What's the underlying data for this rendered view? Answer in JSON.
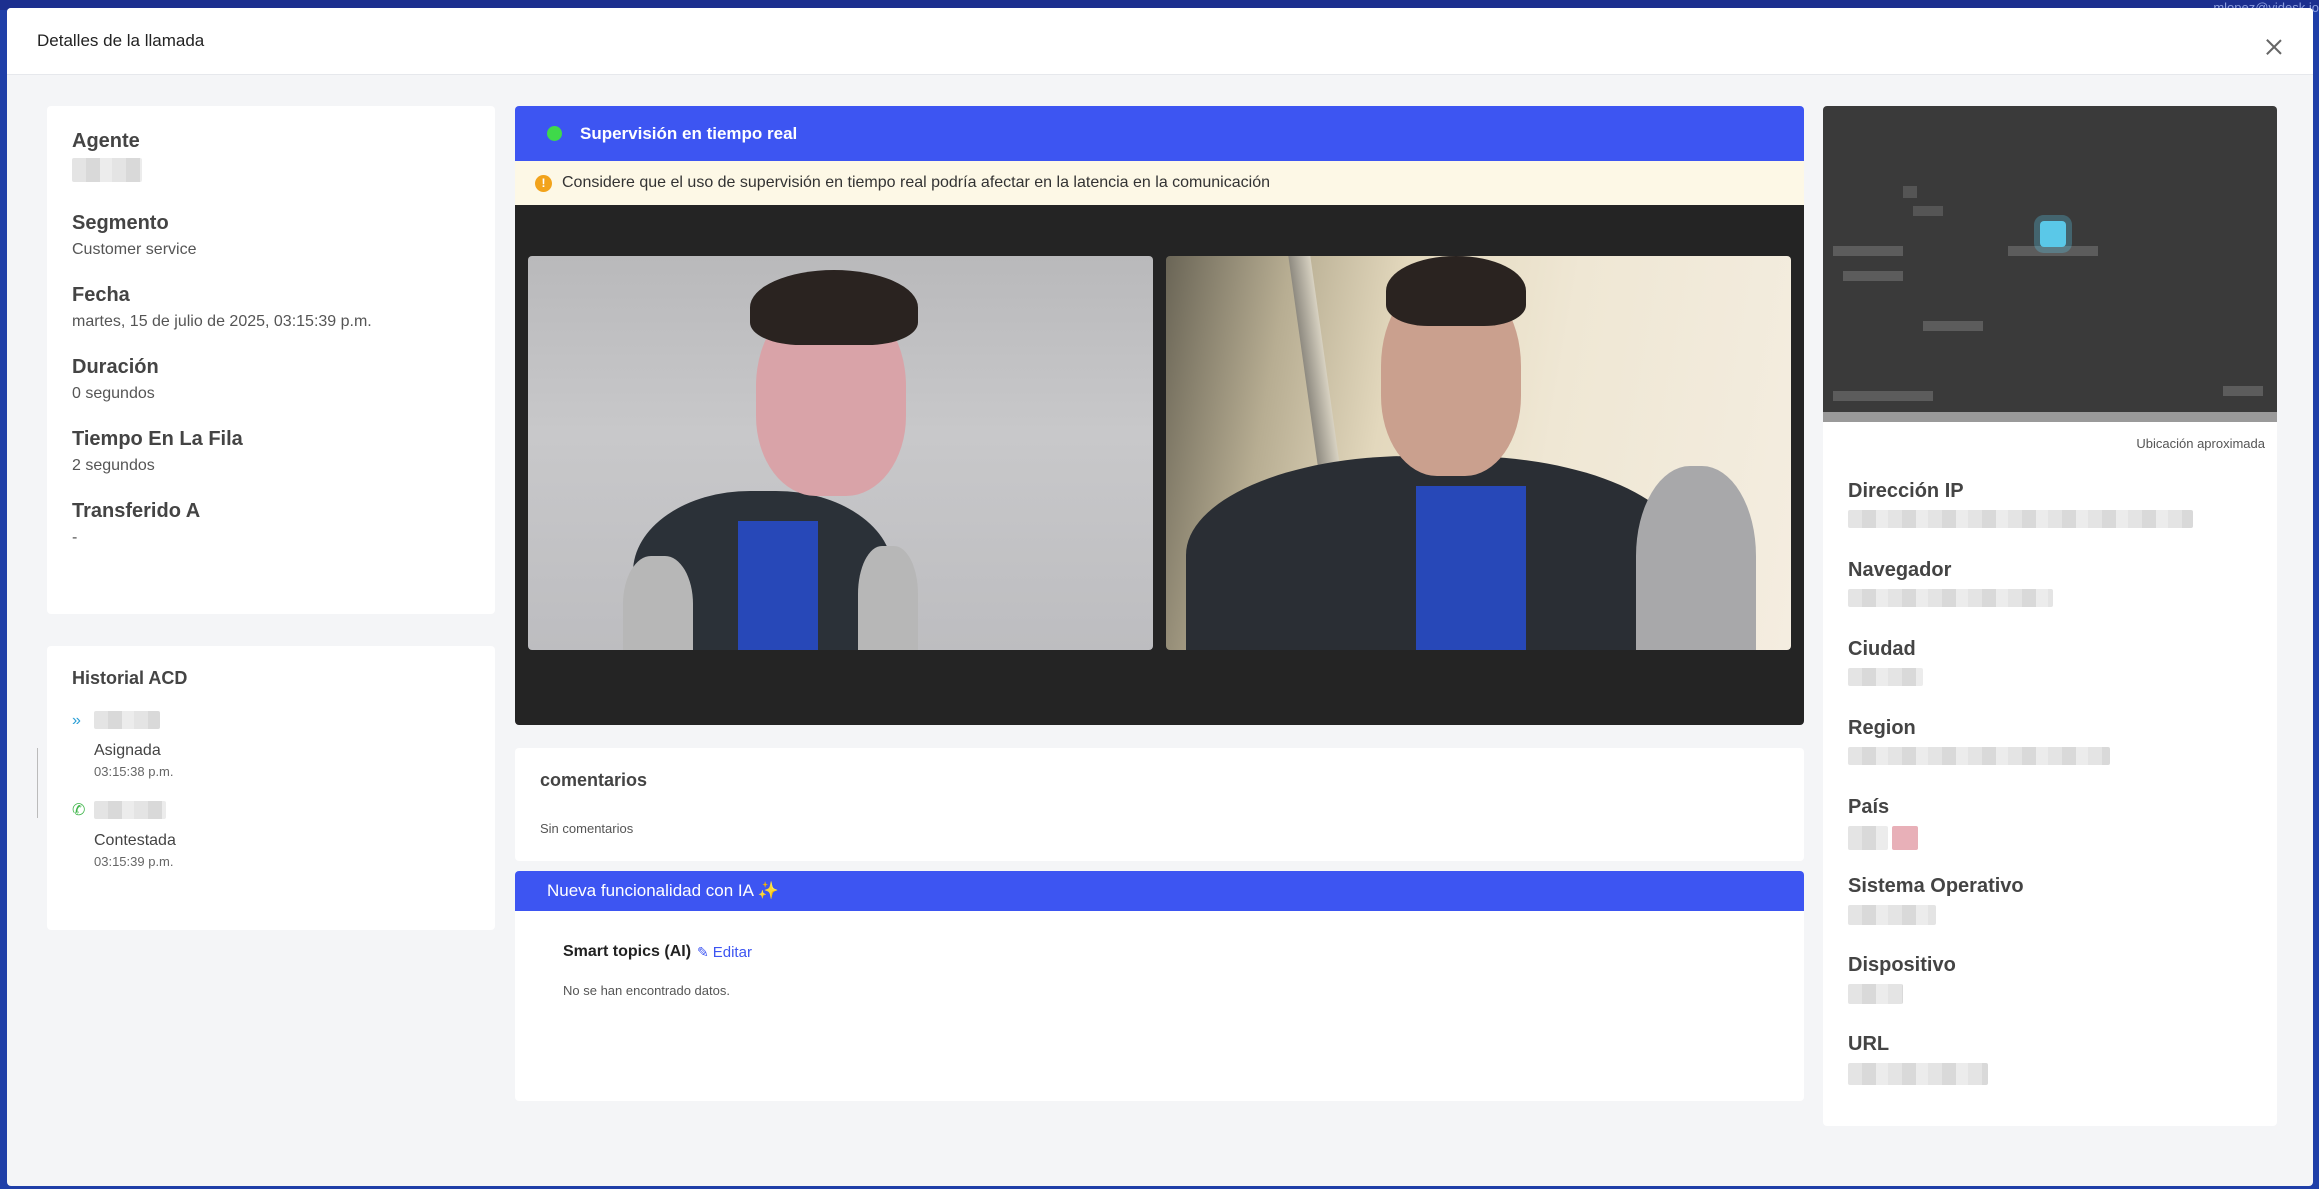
{
  "backdrop": {
    "user_text": "mlopez@videsk.io"
  },
  "modal": {
    "title": "Detalles de la llamada"
  },
  "info": [
    {
      "label": "Agente",
      "value": ""
    },
    {
      "label": "Segmento",
      "value": "Customer service"
    },
    {
      "label": "Fecha",
      "value": "martes, 15 de julio de 2025, 03:15:39 p.m."
    },
    {
      "label": "Duración",
      "value": "0 segundos"
    },
    {
      "label": "Tiempo En La Fila",
      "value": "2 segundos"
    },
    {
      "label": "Transferido A",
      "value": "-"
    }
  ],
  "acd": {
    "title": "Historial ACD",
    "items": [
      {
        "icon": "double-chevron-right-icon",
        "status": "Asignada",
        "time": "03:15:38 p.m."
      },
      {
        "icon": "phone-icon",
        "status": "Contestada",
        "time": "03:15:39 p.m."
      }
    ]
  },
  "supervision": {
    "title": "Supervisión en tiempo real",
    "status_color": "#3fd94a",
    "warning": "Considere que el uso de supervisión en tiempo real podría afectar en la latencia en la comunicación"
  },
  "comments": {
    "title": "comentarios",
    "empty": "Sin comentarios"
  },
  "ai": {
    "title": "Nueva funcionalidad con IA ✨",
    "topic_label": "Smart topics (AI)",
    "edit_label": "Editar",
    "empty": "No se han encontrado datos."
  },
  "location": {
    "approx_label": "Ubicación aproximada",
    "fields": [
      {
        "label": "Dirección IP"
      },
      {
        "label": "Navegador"
      },
      {
        "label": "Ciudad"
      },
      {
        "label": "Region"
      },
      {
        "label": "País"
      },
      {
        "label": "Sistema Operativo"
      },
      {
        "label": "Dispositivo"
      },
      {
        "label": "URL"
      }
    ]
  },
  "colors": {
    "accent": "#3d55f2",
    "warning": "#f2a31b"
  }
}
